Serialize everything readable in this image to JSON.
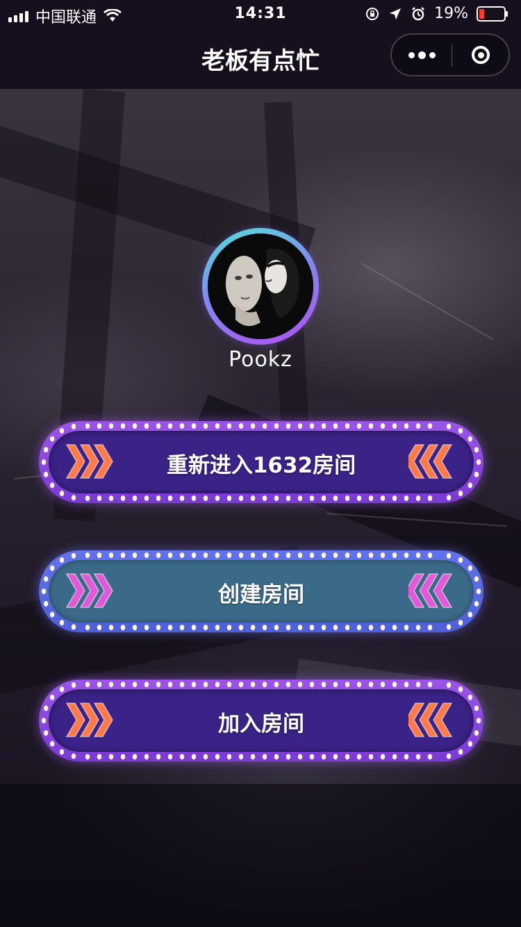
{
  "status_bar": {
    "carrier": "中国联通",
    "time": "14:31",
    "battery_percent": "19%",
    "icons": [
      "signal-icon",
      "wifi-icon",
      "orientation-lock-icon",
      "location-icon",
      "alarm-icon",
      "battery-icon"
    ]
  },
  "nav": {
    "title": "老板有点忙",
    "more_icon": "more-dots-icon",
    "close_icon": "target-circle-icon"
  },
  "profile": {
    "username": "Pookz",
    "ring_colors": [
      "#54e3d6",
      "#7e8cf0",
      "#b24ff0"
    ]
  },
  "buttons": [
    {
      "label": "重新进入1632房间",
      "theme": "purple",
      "chevron_color": "#ff7a4a"
    },
    {
      "label": "创建房间",
      "theme": "teal",
      "chevron_color": "#e05ad8"
    },
    {
      "label": "加入房间",
      "theme": "purple",
      "chevron_color": "#ff7a4a"
    }
  ],
  "colors": {
    "bar_bg": "#150f1e",
    "purple_border": "#9b54e8",
    "purple_fill": "#3a2286",
    "teal_border": "#6272ec",
    "teal_fill": "#3a6a88",
    "bulb": "#fff7d6"
  }
}
